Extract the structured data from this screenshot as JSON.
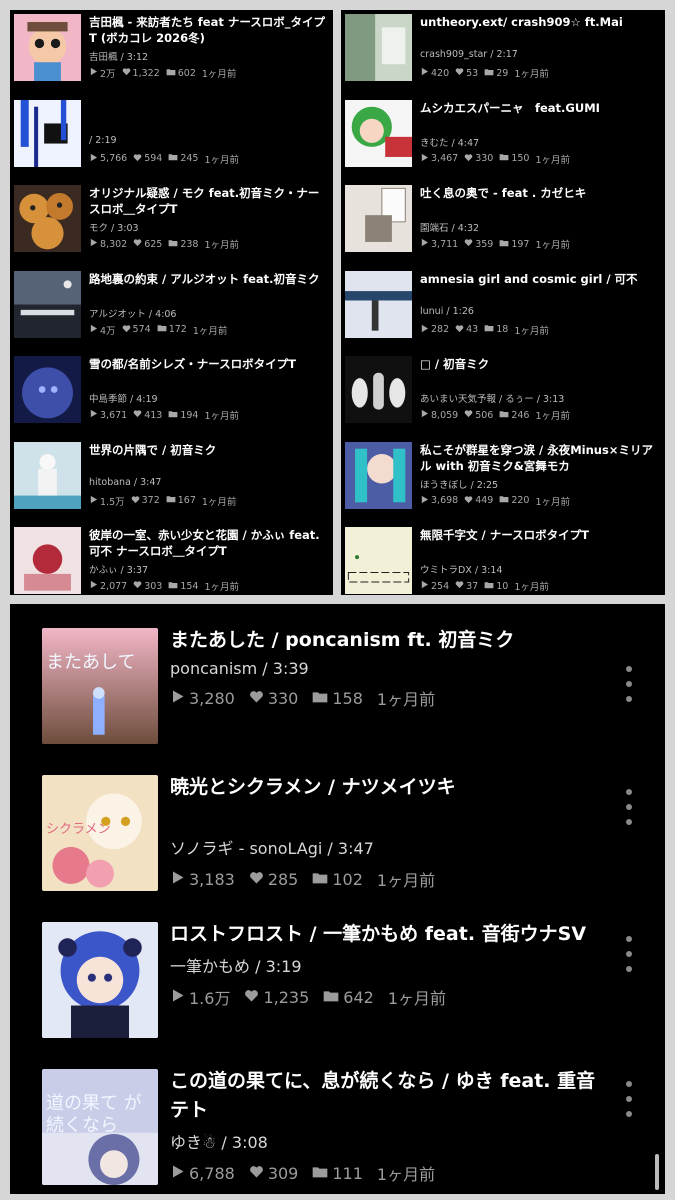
{
  "left_column": [
    {
      "title": "吉田楓 - 来訪者たち feat ナースロボ_タイプT (ボカコレ 2026冬)",
      "meta": "吉田楓 / 3:12",
      "plays": "2万",
      "likes": "1,322",
      "mylists": "602",
      "age": "1ヶ月前",
      "thumb": "thumb-doll",
      "colors": [
        "#f2b7c7",
        "#6e4d3c"
      ]
    },
    {
      "title": "",
      "meta": " / 2:19",
      "plays": "5,766",
      "likes": "594",
      "mylists": "245",
      "age": "1ヶ月前",
      "thumb": "thumb-blue-glitch",
      "colors": [
        "#eef3ff",
        "#2450d6"
      ]
    },
    {
      "title": "オリジナル疑惑 / モク feat.初音ミク・ナースロボ＿タイプT",
      "meta": "モク / 3:03",
      "plays": "8,302",
      "likes": "625",
      "mylists": "238",
      "age": "1ヶ月前",
      "thumb": "thumb-cookie",
      "colors": [
        "#d7913a",
        "#3b2a22"
      ]
    },
    {
      "title": "路地裏の約束 / アルジオット feat.初音ミク",
      "meta": "アルジオット / 4:06",
      "plays": "4万",
      "likes": "574",
      "mylists": "172",
      "age": "1ヶ月前",
      "thumb": "thumb-night-text",
      "colors": [
        "#566277",
        "#20252e"
      ]
    },
    {
      "title": "雪の都/名前シレズ・ナースロボタイプT",
      "meta": "中島季節 / 4:19",
      "plays": "3,671",
      "likes": "413",
      "mylists": "194",
      "age": "1ヶ月前",
      "thumb": "thumb-blue-girl",
      "colors": [
        "#3d4fa8",
        "#121a45"
      ]
    },
    {
      "title": "世界の片隅で / 初音ミク",
      "meta": "hitobana / 3:47",
      "plays": "1.5万",
      "likes": "372",
      "mylists": "167",
      "age": "1ヶ月前",
      "thumb": "thumb-white-figure",
      "colors": [
        "#cfe2ea",
        "#4fa3c0"
      ]
    },
    {
      "title": "彼岸の一室、赤い少女と花園 / かふぃ feat. 可不 ナースロボ＿タイプT",
      "meta": "かふぃ / 3:37",
      "plays": "2,077",
      "likes": "303",
      "mylists": "154",
      "age": "1ヶ月前",
      "thumb": "thumb-red-girl",
      "colors": [
        "#f0e2e2",
        "#b32a3a"
      ]
    }
  ],
  "right_column": [
    {
      "title": "untheory.ext/ crash909☆ ft.Mai",
      "meta": "crash909_star / 2:17",
      "plays": "420",
      "likes": "53",
      "mylists": "29",
      "age": "1ヶ月前",
      "thumb": "thumb-street",
      "colors": [
        "#c9d6c8",
        "#7f9a80"
      ]
    },
    {
      "title": "ムシカエスパーニャ　feat.GUMI",
      "meta": "きむた / 4:47",
      "plays": "3,467",
      "likes": "330",
      "mylists": "150",
      "age": "1ヶ月前",
      "thumb": "thumb-gumi",
      "colors": [
        "#39a845",
        "#c8333a"
      ]
    },
    {
      "title": "吐く息の奥で - feat . カゼヒキ",
      "meta": "園端石 / 4:32",
      "plays": "3,711",
      "likes": "359",
      "mylists": "197",
      "age": "1ヶ月前",
      "thumb": "thumb-room",
      "colors": [
        "#e7e3dc",
        "#8c8378"
      ]
    },
    {
      "title": "amnesia girl and cosmic girl / 可不",
      "meta": "lunui / 1:26",
      "plays": "282",
      "likes": "43",
      "mylists": "18",
      "age": "1ヶ月前",
      "thumb": "thumb-cosmic",
      "colors": [
        "#dfe4ee",
        "#27466c"
      ]
    },
    {
      "title": "□ / 初音ミク",
      "meta": "あいまい天気予報 / るぅー / 3:13",
      "plays": "8,059",
      "likes": "506",
      "mylists": "246",
      "age": "1ヶ月前",
      "thumb": "thumb-hands",
      "colors": [
        "#101010",
        "#e6e6e6"
      ]
    },
    {
      "title": "私こそが群星を穿つ涙 / 永夜Minus×ミリアル with 初音ミク&宮舞モカ",
      "meta": "ほうきぼし / 2:25",
      "plays": "3,698",
      "likes": "449",
      "mylists": "220",
      "age": "1ヶ月前",
      "thumb": "thumb-miku-stars",
      "colors": [
        "#4c5da6",
        "#30c1c8"
      ]
    },
    {
      "title": "無限千字文 / ナースロボタイプT",
      "meta": "ウミトラDX / 3:14",
      "plays": "254",
      "likes": "37",
      "mylists": "10",
      "age": "1ヶ月前",
      "thumb": "thumb-paper",
      "colors": [
        "#f3f0d8",
        "#222"
      ]
    }
  ],
  "bottom_list": [
    {
      "title": "またあした / poncanism ft. 初音ミク",
      "meta": "poncanism  /  3:39",
      "plays": "3,280",
      "likes": "330",
      "mylists": "158",
      "age": "1ヶ月前",
      "thumb": "thumb-mataashita",
      "thumb_text": "またあして",
      "colors": [
        "#2b57d6",
        "#0d2679"
      ]
    },
    {
      "title": "暁光とシクラメン / ナツメイツキ",
      "meta": "ソノラギ - sonoLAgi  /  3:47",
      "plays": "3,183",
      "likes": "285",
      "mylists": "102",
      "age": "1ヶ月前",
      "thumb": "thumb-cyclamen",
      "thumb_text": "シクラメン",
      "colors": [
        "#f2e2c3",
        "#e67a8c"
      ]
    },
    {
      "title": "ロストフロスト / 一筆かもめ feat. 音街ウナSV",
      "meta": "一筆かもめ  /  3:19",
      "plays": "1.6万",
      "likes": "1,235",
      "mylists": "642",
      "age": "1ヶ月前",
      "thumb": "thumb-una",
      "thumb_text": "",
      "colors": [
        "#3a56c8",
        "#1c1f3c"
      ]
    },
    {
      "title": "この道の果てに、息が続くなら / ゆき feat. 重音テト",
      "meta": "ゆき☃  /  3:08",
      "plays": "6,788",
      "likes": "309",
      "mylists": "111",
      "age": "1ヶ月前",
      "thumb": "thumb-teto",
      "thumb_text": "道の果て が続くなら",
      "colors": [
        "#c9cde8",
        "#6a6fa8"
      ]
    }
  ],
  "icons": {
    "play": "play-icon",
    "like": "heart-icon",
    "mylist": "folder-icon",
    "menu": "kebab-menu-icon"
  }
}
